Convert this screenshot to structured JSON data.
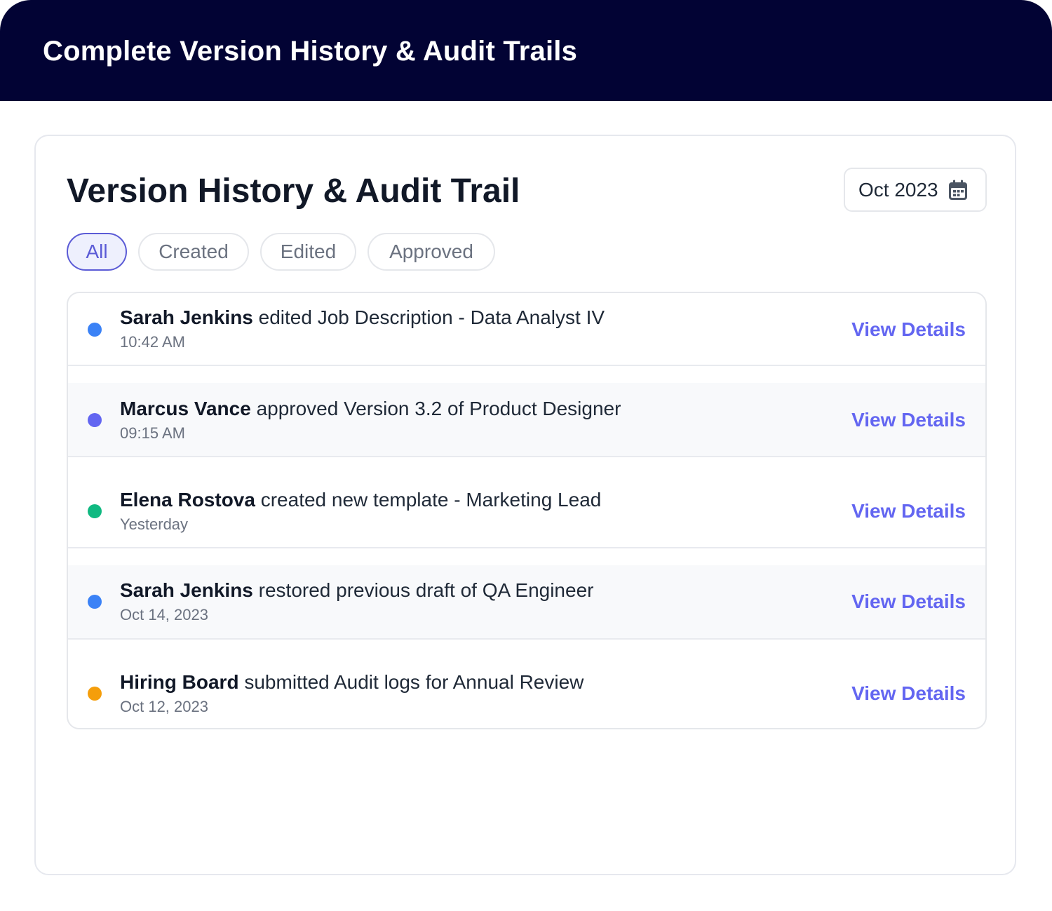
{
  "banner": {
    "title": "Complete Version History & Audit Trails"
  },
  "card": {
    "title": "Version History & Audit Trail",
    "date_filter": {
      "label": "Oct 2023",
      "icon": "calendar-icon"
    },
    "tabs": [
      {
        "label": "All",
        "active": true
      },
      {
        "label": "Created",
        "active": false
      },
      {
        "label": "Edited",
        "active": false
      },
      {
        "label": "Approved",
        "active": false
      }
    ],
    "entries": [
      {
        "actor": "Sarah Jenkins",
        "action": "edited Job Description - Data Analyst IV",
        "time": "10:42 AM",
        "dot_color": "#3b82f6",
        "link": "View Details"
      },
      {
        "actor": "Marcus Vance",
        "action": "approved Version 3.2 of Product Designer",
        "time": "09:15 AM",
        "dot_color": "#6366f1",
        "link": "View Details"
      },
      {
        "actor": "Elena Rostova",
        "action": "created new template - Marketing Lead",
        "time": "Yesterday",
        "dot_color": "#10b981",
        "link": "View Details"
      },
      {
        "actor": "Sarah Jenkins",
        "action": "restored previous draft of QA Engineer",
        "time": "Oct 14, 2023",
        "dot_color": "#3b82f6",
        "link": "View Details"
      },
      {
        "actor": "Hiring Board",
        "action": "submitted Audit logs for Annual Review",
        "time": "Oct 12, 2023",
        "dot_color": "#f59e0b",
        "link": "View Details"
      }
    ]
  },
  "colors": {
    "banner_bg": "#020334",
    "accent": "#5b5bd6",
    "link": "#6366f1"
  }
}
